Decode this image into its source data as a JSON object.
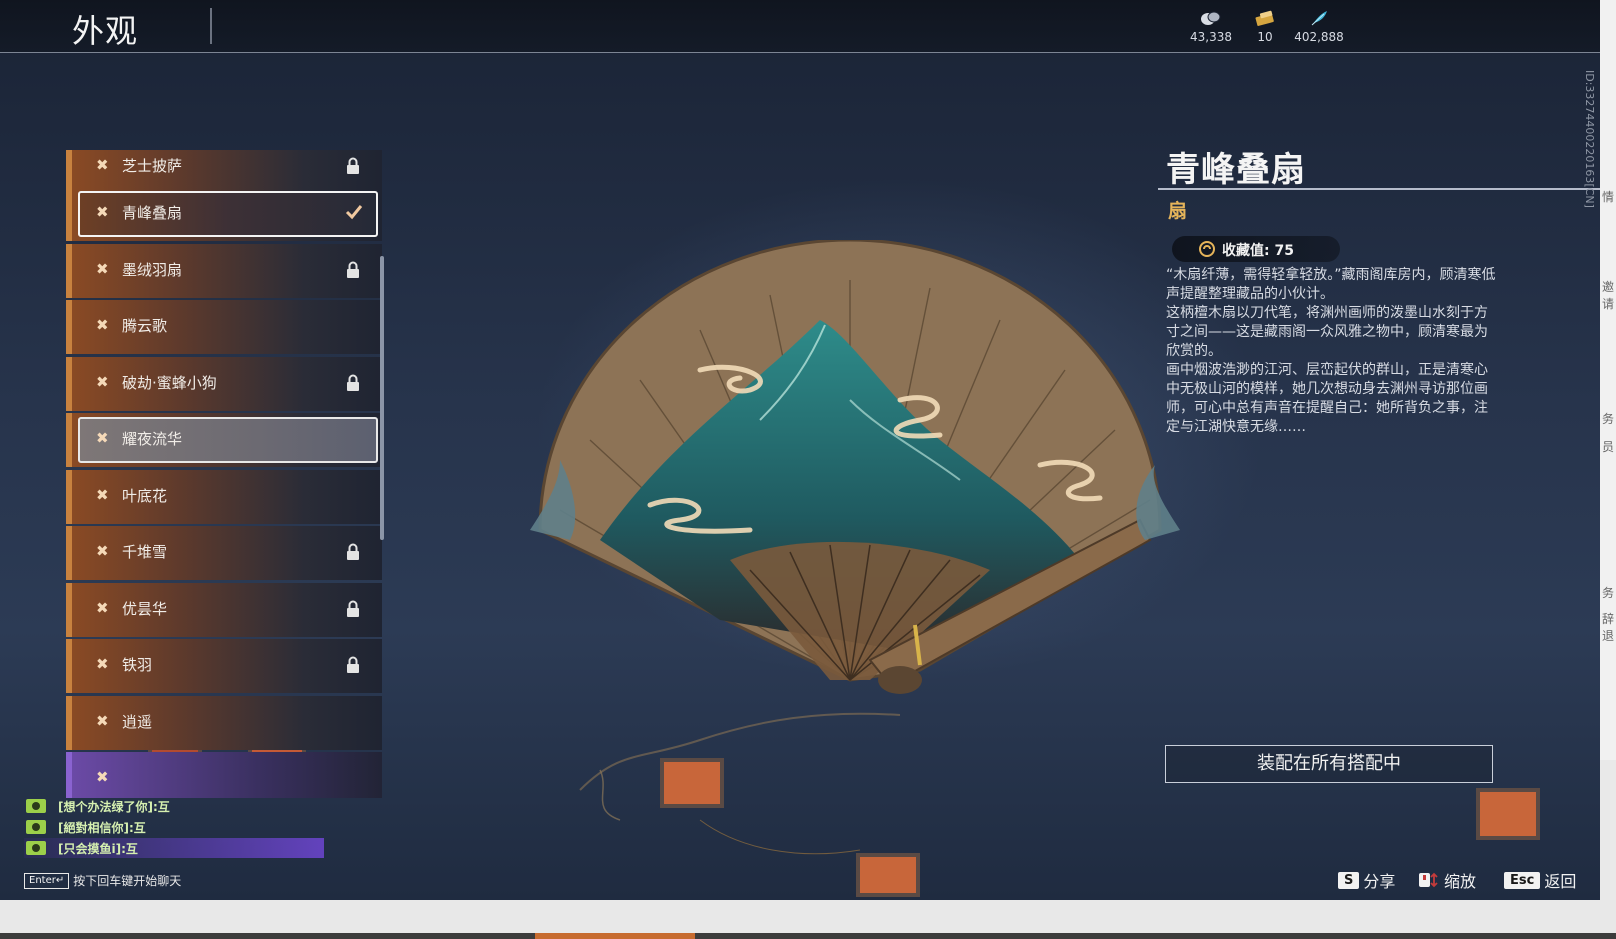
{
  "header": {
    "title": "外观",
    "currencies": [
      {
        "icon": "coin-icon",
        "value": "43,338"
      },
      {
        "icon": "ticket-icon",
        "value": "10"
      },
      {
        "icon": "feather-icon",
        "value": "402,888"
      }
    ]
  },
  "list": {
    "items": [
      {
        "label": "芝士披萨",
        "locked": true
      },
      {
        "label": "青峰叠扇",
        "selected": true
      },
      {
        "label": "墨绒羽扇",
        "locked": true
      },
      {
        "label": "腾云歌",
        "locked": false
      },
      {
        "label": "破劫·蜜蜂小狗",
        "locked": true
      },
      {
        "label": "耀夜流华",
        "locked": false,
        "hover": true
      },
      {
        "label": "叶底花",
        "locked": false
      },
      {
        "label": "千堆雪",
        "locked": true
      },
      {
        "label": "优昙华",
        "locked": true
      },
      {
        "label": "铁羽",
        "locked": true
      },
      {
        "label": "逍遥",
        "locked": false
      },
      {
        "label": "",
        "locked": false,
        "purple": true
      }
    ]
  },
  "detail": {
    "name": "青峰叠扇",
    "type": "扇",
    "collect_label": "收藏值: 75",
    "description": [
      "“木扇纤薄，需得轻拿轻放。”藏雨阁库房内，顾清寒低声提醒整理藏品的小伙计。",
      "这柄檀木扇以刀代笔，将渊州画师的泼墨山水刻于方寸之间——这是藏雨阁一众风雅之物中，顾清寒最为欣赏的。",
      "画中烟波浩渺的江河、层峦起伏的群山，正是清寒心中无极山河的模样，她几次想动身去渊州寻访那位画师，可心中总有声音在提醒自己：她所背负之事，注定与江湖快意无缘……"
    ],
    "equip_button": "装配在所有搭配中"
  },
  "hints": {
    "share_key": "S",
    "share_label": "分享",
    "zoom_label": "缩放",
    "back_key": "Esc",
    "back_label": "返回"
  },
  "chat": {
    "lines": [
      "[想个办法绿了你]:互",
      "[絕對相信你]:互",
      "[只会摸鱼i]:互"
    ],
    "enter_key": "Enter↵",
    "hint": "按下回车键开始聊天"
  },
  "id_text": "ID:3327440022016​3[CN]",
  "side_panel": [
    "情",
    "邀请",
    "务",
    "员",
    "务",
    "辞退"
  ],
  "colors": {
    "accent_orange": "#c8823f",
    "type_gold": "#e5b45a",
    "chat_green": "#d6f0b0"
  }
}
